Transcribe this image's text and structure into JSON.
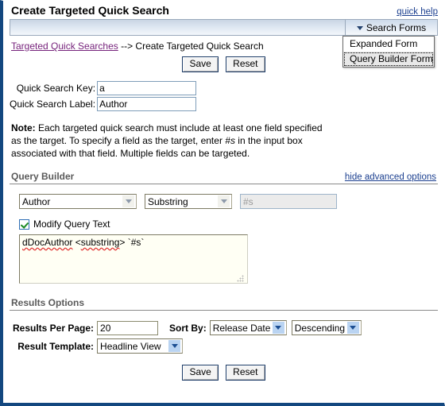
{
  "window": {
    "title": "Create Targeted Quick Search",
    "quick_help": "quick help",
    "border_color": "#13477f"
  },
  "search": {
    "value": "",
    "placeholder": "",
    "forms_button_label": "Search Forms",
    "menu": [
      {
        "label": "Expanded Form",
        "highlighted": false
      },
      {
        "label": "Query Builder Form",
        "highlighted": true
      }
    ]
  },
  "breadcrumb": {
    "link": "Targeted Quick Searches",
    "separator": " --> ",
    "current": "Create Targeted Quick Search"
  },
  "top_buttons": {
    "save": "Save",
    "reset": "Reset"
  },
  "fields": {
    "key_label": "Quick Search Key:",
    "key_value": "a",
    "label_label": "Quick Search Label:",
    "label_value": "Author"
  },
  "note": {
    "prefix": "Note:",
    "part1": " Each targeted quick search must include at least one field specified as the target. To specify a field as the target, enter ",
    "token": "#s",
    "part2": " in the input box associated with that field. Multiple fields can be targeted."
  },
  "query_builder": {
    "section_title": "Query Builder",
    "toggle_link": "hide advanced options",
    "field_select": "Author",
    "operator_select": "Substring",
    "value_input": "#s",
    "value_input_disabled": true,
    "modify_checkbox_label": "Modify Query Text",
    "modify_checkbox_checked": true,
    "query_text": "dDocAuthor <substring> `#s`",
    "query_text_tokens": [
      "dDocAuthor",
      "substring"
    ]
  },
  "results_options": {
    "section_title": "Results Options",
    "per_page_label": "Results Per Page:",
    "per_page_value": "20",
    "sort_by_label": "Sort By:",
    "sort_by_value": "Release Date",
    "sort_dir_value": "Descending",
    "template_label": "Result Template:",
    "template_value": "Headline View"
  },
  "bottom_buttons": {
    "save": "Save",
    "reset": "Reset"
  },
  "colors": {
    "link_blue": "#1b3f8f",
    "link_visited_purple": "#76227b",
    "section_gray": "#5a5a5a",
    "window_border": "#13477f"
  }
}
